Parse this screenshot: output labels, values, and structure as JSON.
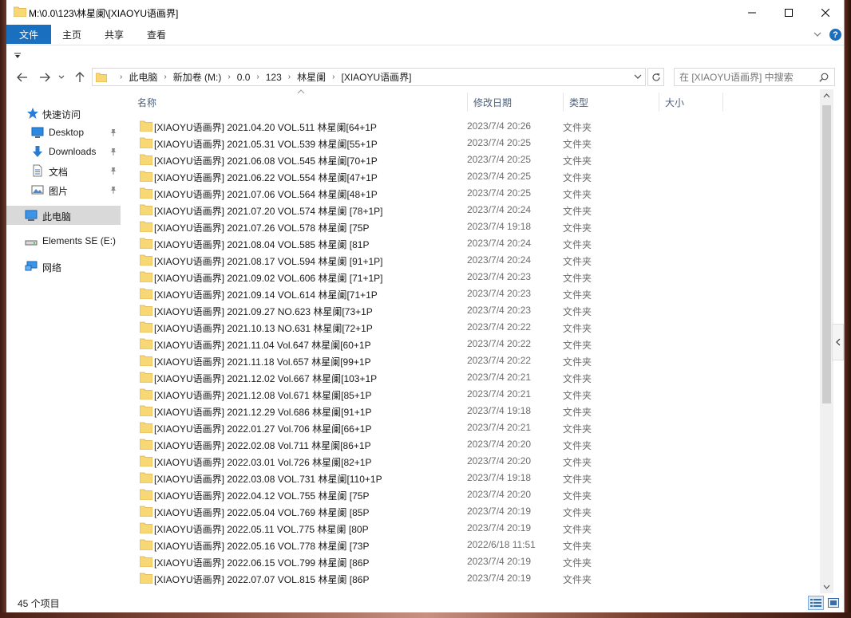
{
  "window": {
    "title": "M:\\0.0\\123\\林星阑\\[XIAOYU语画界]"
  },
  "ribbon": {
    "tabs": [
      {
        "label": "文件"
      },
      {
        "label": "主页"
      },
      {
        "label": "共享"
      },
      {
        "label": "查看"
      }
    ],
    "help_label": "?"
  },
  "address": {
    "crumbs": [
      "此电脑",
      "新加卷 (M:)",
      "0.0",
      "123",
      "林星阑",
      "[XIAOYU语画界]"
    ]
  },
  "search": {
    "placeholder": "在 [XIAOYU语画界] 中搜索"
  },
  "nav": {
    "quick_access": "快速访问",
    "items": [
      {
        "label": "Desktop",
        "icon": "desktop-icon",
        "pinned": true
      },
      {
        "label": "Downloads",
        "icon": "download-icon",
        "pinned": true
      },
      {
        "label": "文档",
        "icon": "document-icon",
        "pinned": true
      },
      {
        "label": "图片",
        "icon": "pictures-icon",
        "pinned": true
      }
    ],
    "this_pc": "此电脑",
    "drive": "Elements SE (E:)",
    "network": "网络"
  },
  "columns": {
    "name": "名称",
    "date": "修改日期",
    "type": "类型",
    "size": "大小"
  },
  "files": [
    {
      "name": "[XIAOYU语画界] 2021.04.20 VOL.511 林星阑[64+1P",
      "date": "2023/7/4 20:26",
      "type": "文件夹"
    },
    {
      "name": "[XIAOYU语画界] 2021.05.31 VOL.539 林星阑[55+1P",
      "date": "2023/7/4 20:25",
      "type": "文件夹"
    },
    {
      "name": "[XIAOYU语画界] 2021.06.08 VOL.545 林星阑[70+1P",
      "date": "2023/7/4 20:25",
      "type": "文件夹"
    },
    {
      "name": "[XIAOYU语画界] 2021.06.22 VOL.554 林星阑[47+1P",
      "date": "2023/7/4 20:25",
      "type": "文件夹"
    },
    {
      "name": "[XIAOYU语画界] 2021.07.06 VOL.564 林星阑[48+1P",
      "date": "2023/7/4 20:25",
      "type": "文件夹"
    },
    {
      "name": "[XIAOYU语画界] 2021.07.20 VOL.574 林星阑 [78+1P]",
      "date": "2023/7/4 20:24",
      "type": "文件夹"
    },
    {
      "name": "[XIAOYU语画界] 2021.07.26 VOL.578 林星阑 [75P",
      "date": "2023/7/4 19:18",
      "type": "文件夹"
    },
    {
      "name": "[XIAOYU语画界] 2021.08.04 VOL.585 林星阑 [81P",
      "date": "2023/7/4 20:24",
      "type": "文件夹"
    },
    {
      "name": "[XIAOYU语画界] 2021.08.17 VOL.594 林星阑 [91+1P]",
      "date": "2023/7/4 20:24",
      "type": "文件夹"
    },
    {
      "name": "[XIAOYU语画界] 2021.09.02 VOL.606 林星阑 [71+1P]",
      "date": "2023/7/4 20:23",
      "type": "文件夹"
    },
    {
      "name": "[XIAOYU语画界] 2021.09.14 VOL.614 林星阑[71+1P",
      "date": "2023/7/4 20:23",
      "type": "文件夹"
    },
    {
      "name": "[XIAOYU语画界] 2021.09.27 NO.623 林星阑[73+1P",
      "date": "2023/7/4 20:23",
      "type": "文件夹"
    },
    {
      "name": "[XIAOYU语画界] 2021.10.13 NO.631 林星阑[72+1P",
      "date": "2023/7/4 20:22",
      "type": "文件夹"
    },
    {
      "name": "[XIAOYU语画界] 2021.11.04 Vol.647 林星阑[60+1P",
      "date": "2023/7/4 20:22",
      "type": "文件夹"
    },
    {
      "name": "[XIAOYU语画界] 2021.11.18 Vol.657 林星阑[99+1P",
      "date": "2023/7/4 20:22",
      "type": "文件夹"
    },
    {
      "name": "[XIAOYU语画界] 2021.12.02 Vol.667 林星阑[103+1P",
      "date": "2023/7/4 20:21",
      "type": "文件夹"
    },
    {
      "name": "[XIAOYU语画界] 2021.12.08 Vol.671 林星阑[85+1P",
      "date": "2023/7/4 20:21",
      "type": "文件夹"
    },
    {
      "name": "[XIAOYU语画界] 2021.12.29 Vol.686 林星阑[91+1P",
      "date": "2023/7/4 19:18",
      "type": "文件夹"
    },
    {
      "name": "[XIAOYU语画界] 2022.01.27 Vol.706 林星阑[66+1P",
      "date": "2023/7/4 20:21",
      "type": "文件夹"
    },
    {
      "name": "[XIAOYU语画界] 2022.02.08 Vol.711 林星阑[86+1P",
      "date": "2023/7/4 20:20",
      "type": "文件夹"
    },
    {
      "name": "[XIAOYU语画界] 2022.03.01 Vol.726 林星阑[82+1P",
      "date": "2023/7/4 20:20",
      "type": "文件夹"
    },
    {
      "name": "[XIAOYU语画界] 2022.03.08 VOL.731 林星阑[110+1P",
      "date": "2023/7/4 19:18",
      "type": "文件夹"
    },
    {
      "name": "[XIAOYU语画界] 2022.04.12 VOL.755 林星阑 [75P",
      "date": "2023/7/4 20:20",
      "type": "文件夹"
    },
    {
      "name": "[XIAOYU语画界] 2022.05.04 VOL.769 林星阑 [85P",
      "date": "2023/7/4 20:19",
      "type": "文件夹"
    },
    {
      "name": "[XIAOYU语画界] 2022.05.11 VOL.775 林星阑 [80P",
      "date": "2023/7/4 20:19",
      "type": "文件夹"
    },
    {
      "name": "[XIAOYU语画界] 2022.05.16 VOL.778 林星阑 [73P",
      "date": "2022/6/18 11:51",
      "type": "文件夹"
    },
    {
      "name": "[XIAOYU语画界] 2022.06.15 VOL.799 林星阑 [86P",
      "date": "2023/7/4 20:19",
      "type": "文件夹"
    },
    {
      "name": "[XIAOYU语画界] 2022.07.07 VOL.815 林星阑 [86P",
      "date": "2023/7/4 20:19",
      "type": "文件夹"
    }
  ],
  "status": {
    "count": "45 个项目"
  },
  "colors": {
    "accent": "#1a6fbf",
    "folder": "#f8d775",
    "selected": "#d9d9d9"
  }
}
